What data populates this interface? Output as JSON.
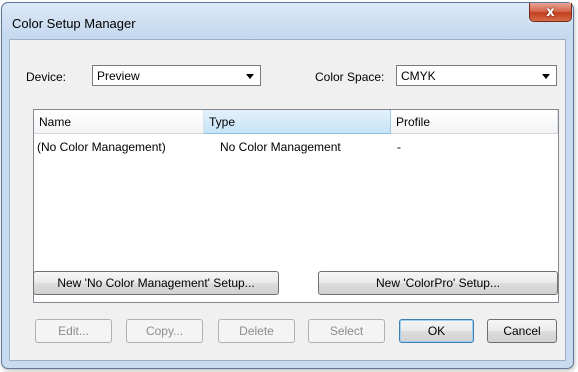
{
  "window": {
    "title": "Color Setup Manager",
    "close_glyph": "x"
  },
  "device": {
    "label": "Device:",
    "value": "Preview"
  },
  "color_space": {
    "label": "Color Space:",
    "value": "CMYK"
  },
  "list": {
    "columns": [
      "Name",
      "Type",
      "Profile"
    ],
    "rows": [
      [
        "(No Color Management)",
        "No Color Management",
        "-"
      ]
    ]
  },
  "setup_buttons": {
    "no_cm": "New 'No Color Management' Setup...",
    "colorpro": "New 'ColorPro' Setup..."
  },
  "actions": {
    "edit": "Edit...",
    "copy": "Copy...",
    "delete": "Delete",
    "select": "Select",
    "ok": "OK",
    "cancel": "Cancel"
  }
}
